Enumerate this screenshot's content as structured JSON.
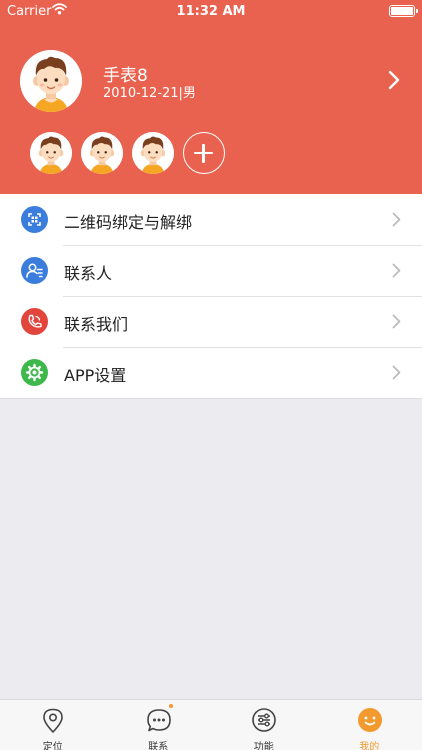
{
  "status_bar": {
    "carrier": "Carrier",
    "time": "11:32 AM"
  },
  "profile": {
    "name": "手表8",
    "subtitle": "2010-12-21|男"
  },
  "menu": {
    "items": [
      {
        "label": "二维码绑定与解绑",
        "icon": "qrcode-scan-icon",
        "color": "#3B7DDD"
      },
      {
        "label": "联系人",
        "icon": "contact-person-icon",
        "color": "#3B7DDD"
      },
      {
        "label": "联系我们",
        "icon": "phone-call-icon",
        "color": "#E2453C"
      },
      {
        "label": "APP设置",
        "icon": "gear-icon",
        "color": "#3DB94C"
      }
    ]
  },
  "tabbar": {
    "items": [
      {
        "label": "定位",
        "icon": "location-pin-icon"
      },
      {
        "label": "联系",
        "icon": "chat-bubble-icon"
      },
      {
        "label": "功能",
        "icon": "sliders-icon"
      },
      {
        "label": "我的",
        "icon": "smiley-face-icon"
      }
    ],
    "active_color": "#F29A2E"
  },
  "colors": {
    "header": "#E9624F",
    "background": "#EBEBF0"
  }
}
